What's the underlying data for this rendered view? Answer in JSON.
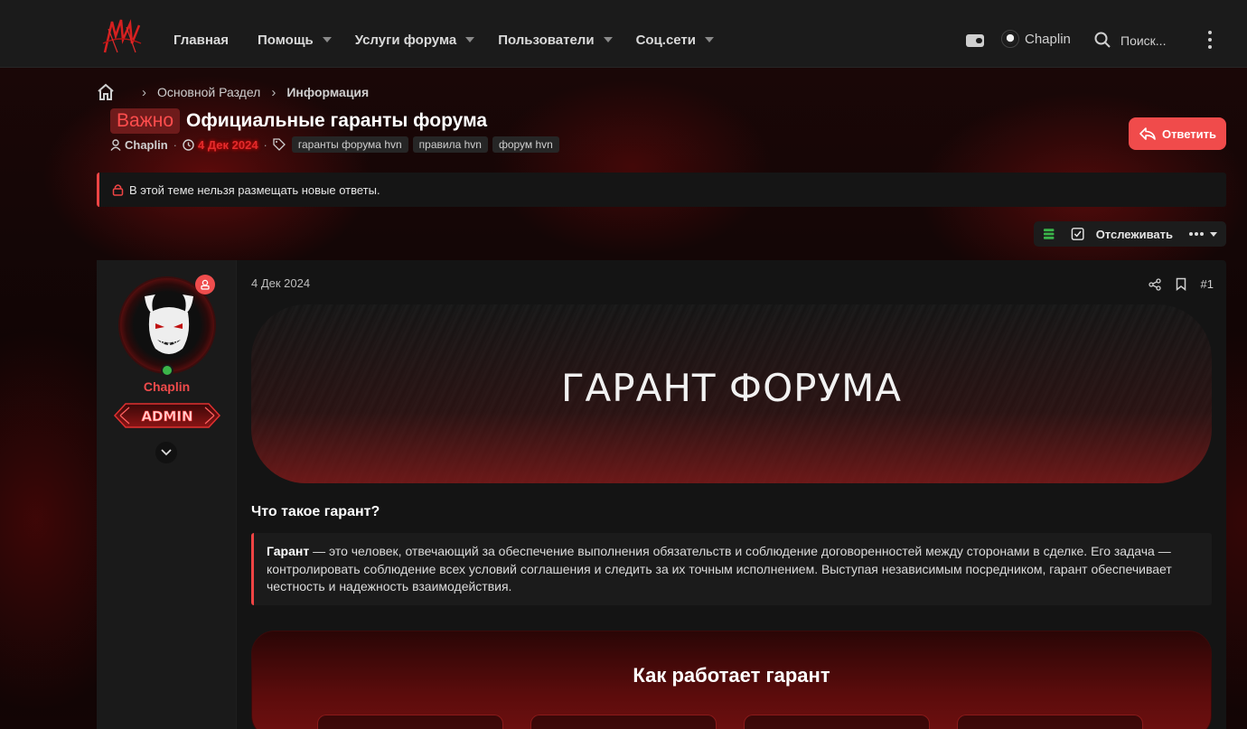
{
  "header": {
    "nav": [
      {
        "label": "Главная",
        "has_dropdown": false
      },
      {
        "label": "Помощь",
        "has_dropdown": true
      },
      {
        "label": "Услуги форума",
        "has_dropdown": true
      },
      {
        "label": "Пользователи",
        "has_dropdown": true
      },
      {
        "label": "Соц.сети",
        "has_dropdown": true
      }
    ],
    "username": "Chaplin",
    "search_label": "Поиск..."
  },
  "breadcrumb": {
    "items": [
      "Основной Раздел",
      "Информация"
    ]
  },
  "thread": {
    "prefix": "Важно",
    "title": "Официальные гаранты форума",
    "author": "Chaplin",
    "date": "4 Дек 2024",
    "tags": [
      "гаранты форума hvn",
      "правила hvn",
      "форум hvn"
    ],
    "reply_label": "Ответить"
  },
  "notice": {
    "text": "В этой теме нельзя размещать новые ответы."
  },
  "toolbar": {
    "watch_label": "Отслеживать"
  },
  "post": {
    "user": {
      "name": "Chaplin",
      "banner": "ADMIN",
      "online": true
    },
    "date": "4 Дек 2024",
    "number": "#1",
    "hero_title": "ГАРАНТ ФОРУМА",
    "section_heading": "Что такое гарант?",
    "quote": {
      "term": "Гарант",
      "text": " — это человек, отвечающий за обеспечение выполнения обязательств и соблюдение договоренностей между сторонами в сделке. Его задача — контролировать соблюдение всех условий соглашения и следить за их точным исполнением. Выступая независимым посредником, гарант обеспечивает честность и надежность взаимодействия."
    },
    "how_title": "Как работает гарант"
  },
  "colors": {
    "accent": "#f04b4b",
    "online": "#3bb54a",
    "topbar": "#1b1b1b"
  }
}
